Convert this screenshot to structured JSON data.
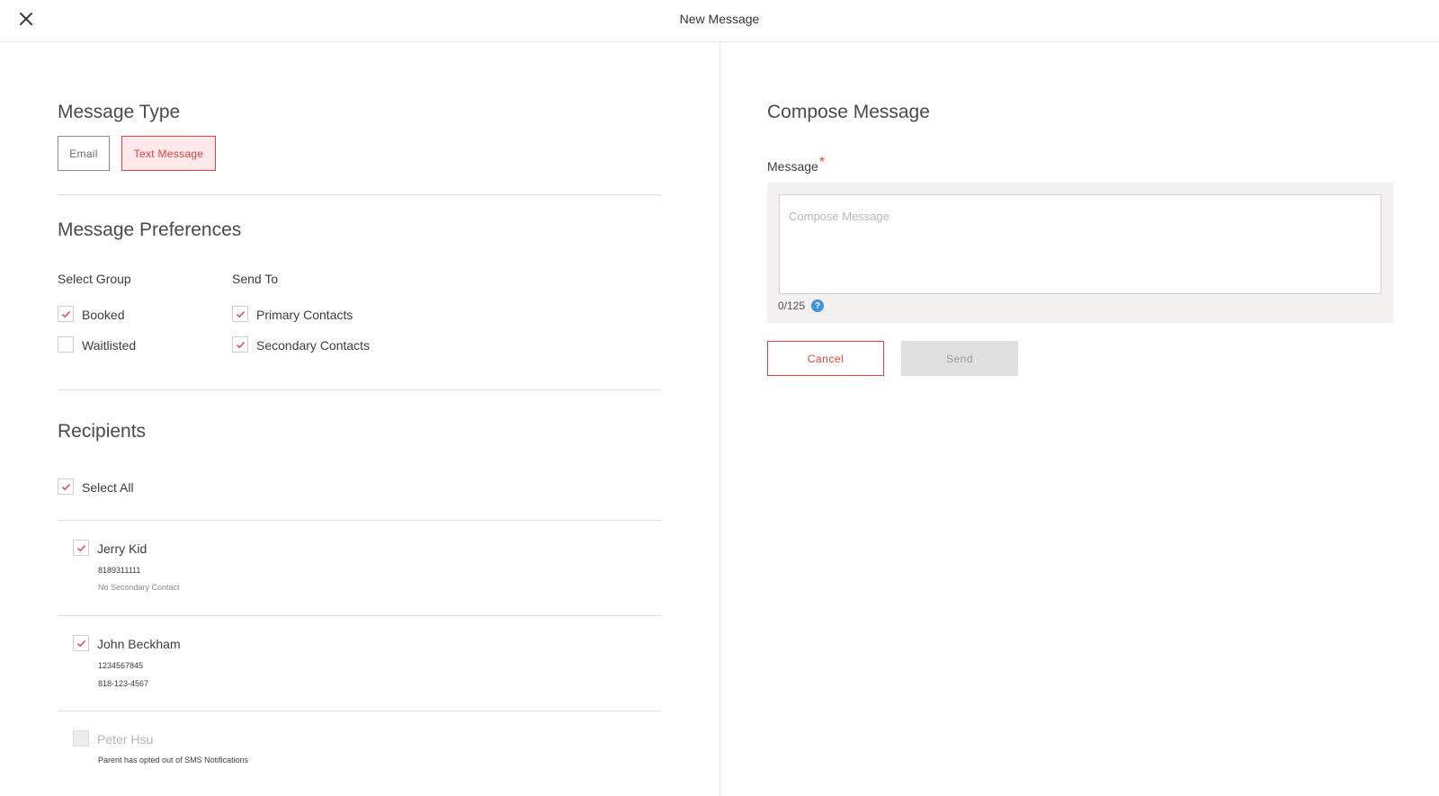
{
  "header": {
    "title": "New Message",
    "close_icon": "close-icon"
  },
  "message_type": {
    "title": "Message Type",
    "options": [
      {
        "label": "Email",
        "selected": false
      },
      {
        "label": "Text Message",
        "selected": true
      }
    ]
  },
  "preferences": {
    "title": "Message Preferences",
    "select_group": {
      "label": "Select Group",
      "options": [
        {
          "label": "Booked",
          "checked": true
        },
        {
          "label": "Waitlisted",
          "checked": false
        }
      ]
    },
    "send_to": {
      "label": "Send To",
      "options": [
        {
          "label": "Primary Contacts",
          "checked": true
        },
        {
          "label": "Secondary Contacts",
          "checked": true
        }
      ]
    }
  },
  "recipients": {
    "title": "Recipients",
    "select_all": {
      "label": "Select All",
      "checked": true
    },
    "items": [
      {
        "name": "Jerry Kid",
        "checked": true,
        "primary": "8189311111",
        "secondary": "No Secondary Contact",
        "disabled": false
      },
      {
        "name": "John Beckham",
        "checked": true,
        "primary": "1234567845",
        "secondary": "818-123-4567",
        "disabled": false
      },
      {
        "name": "Peter Hsu",
        "checked": false,
        "note": "Parent has opted out of SMS Notifications",
        "disabled": true
      }
    ]
  },
  "compose": {
    "title": "Compose Message",
    "label": "Message",
    "required_mark": "*",
    "placeholder": "Compose Message",
    "value": "",
    "counter": "0/125",
    "help_icon": "?",
    "cancel_label": "Cancel",
    "send_label": "Send"
  },
  "colors": {
    "accent": "#e8403f",
    "accent_bg": "#fde9e9",
    "panel_bg": "#f3f1ef",
    "help": "#3b95de",
    "disabled_btn": "#e0e0e0"
  }
}
